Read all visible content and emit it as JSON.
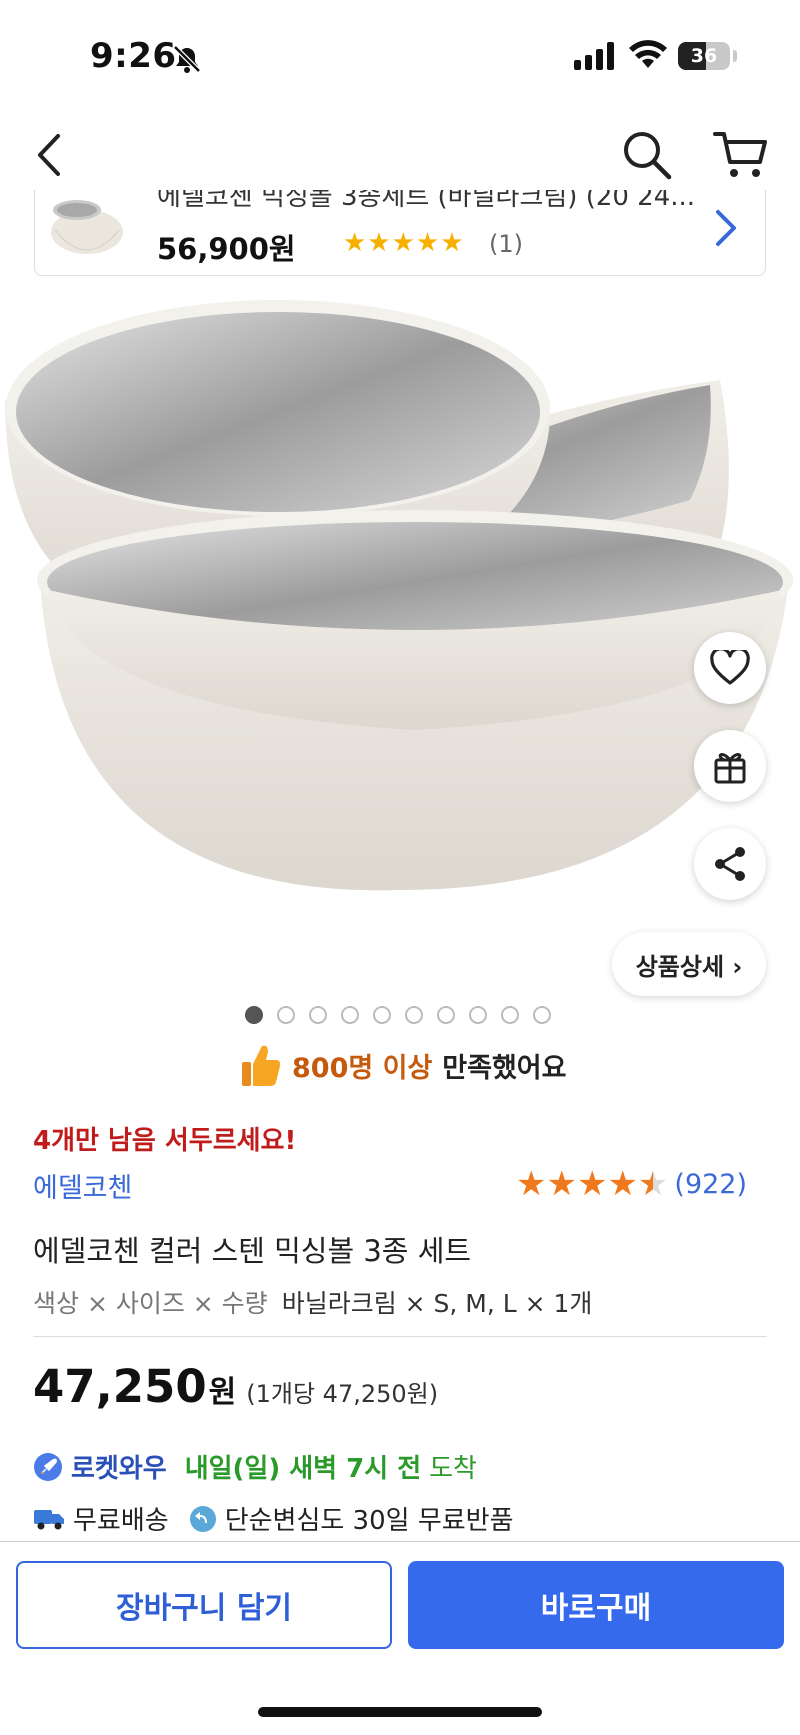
{
  "status_bar": {
    "time": "9:26",
    "battery": "36"
  },
  "mini_product": {
    "title": "에델코첸 믹싱볼 3종세트 (바닐라크림) (20 24...",
    "price": "56,900원",
    "stars": "★★★★★",
    "review_count": "(1)"
  },
  "gallery": {
    "detail_button": "상품상세 ›",
    "page_count": 10,
    "active_page": 1
  },
  "satisfaction": {
    "highlight": "800명 이상",
    "rest": "만족했어요"
  },
  "urgency": "4개만 남음 서두르세요!",
  "brand": "에델코첸",
  "rating": {
    "value": 4.5,
    "count": "(922)"
  },
  "product_name": "에델코첸 컬러 스텐 믹싱볼 3종 세트",
  "options": {
    "label": "색상 × 사이즈 × 수량",
    "value": "바닐라크림 × S, M, L × 1개"
  },
  "price": {
    "amount": "47,250",
    "currency": "원",
    "unit_price": "(1개당 47,250원)"
  },
  "delivery": {
    "badge": "로켓와우",
    "date": "내일(일) 새벽 7시 전",
    "arrive": "도착",
    "free_shipping": "무료배송",
    "free_return": "단순변심도 30일 무료반품"
  },
  "actions": {
    "cart": "장바구니 담기",
    "buy": "바로구매"
  },
  "colors": {
    "accent_blue": "#346aeb",
    "star_orange": "#f0791e",
    "urgency_red": "#c01c1c",
    "rocket_green": "#2a9a2a"
  }
}
